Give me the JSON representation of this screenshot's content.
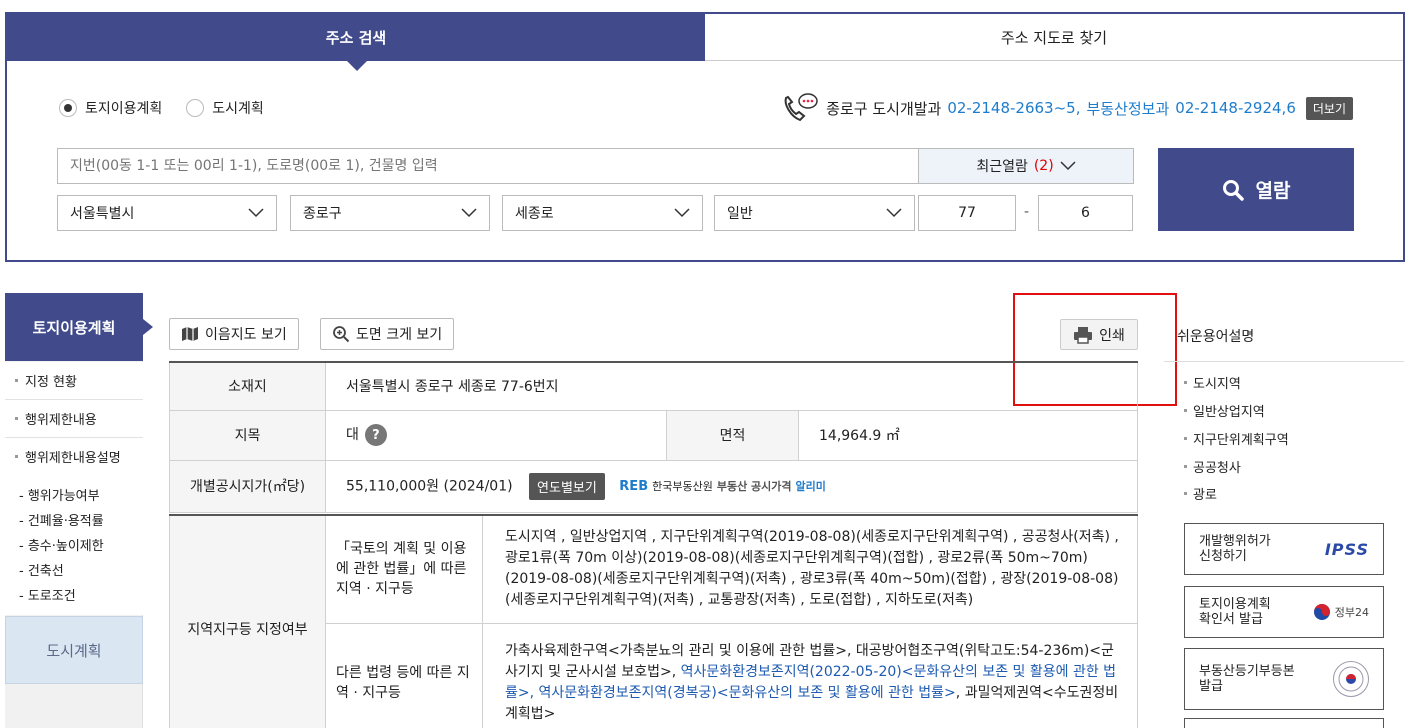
{
  "tabs": {
    "address_search": "주소 검색",
    "map_search": "주소 지도로 찾기"
  },
  "search": {
    "radio_land": "토지이용계획",
    "radio_city": "도시계획",
    "contact_label": "종로구 도시개발과",
    "contact_phone1": "02-2148-2663~5,",
    "contact_label2": "부동산정보과",
    "contact_phone2": "02-2148-2924,6",
    "more_label": "더보기",
    "placeholder": "지번(00동 1-1 또는 00리 1-1), 도로명(00로 1), 건물명 입력",
    "recent_label": "최근열람",
    "recent_count": "(2)",
    "city": "서울특별시",
    "district": "종로구",
    "road": "세종로",
    "type": "일반",
    "main_no": "77",
    "dash": "-",
    "sub_no": "6",
    "view_label": "열람"
  },
  "sidebar": {
    "title": "토지이용계획",
    "items": [
      "지정 현황",
      "행위제한내용",
      "행위제한내용설명"
    ],
    "sub_items": [
      "- 행위가능여부",
      "- 건폐율·용적률",
      "- 층수·높이제한",
      "- 건축선",
      "- 도로조건"
    ],
    "city_plan": "도시계획"
  },
  "toolbar": {
    "map_view": "이음지도 보기",
    "zoom_view": "도면 크게 보기",
    "print": "인쇄"
  },
  "table": {
    "location_label": "소재지",
    "location_value": "서울특별시 종로구 세종로 77-6번지",
    "category_label": "지목",
    "category_value": "대",
    "help": "?",
    "area_label": "면적",
    "area_value": "14,964.9 ㎡",
    "price_label": "개별공시지가(㎡당)",
    "price_value": "55,110,000원 (2024/01)",
    "yearly_btn": "연도별보기",
    "reb_logo": "REB",
    "reb_name": "한국부동산원",
    "reb_service": "부동산 공시가격",
    "reb_alimi": "알리미",
    "zone_label": "지역지구등 지정여부",
    "law1_label": "「국토의 계획 및 이용에 관한 법률」에 따른 지역 · 지구등",
    "law1_value": "도시지역 , 일반상업지역 , 지구단위계획구역(2019-08-08)(세종로지구단위계획구역) , 공공청사(저촉) , 광로1류(폭 70m 이상)(2019-08-08)(세종로지구단위계획구역)(접합) , 광로2류(폭 50m~70m)(2019-08-08)(세종로지구단위계획구역)(저촉) , 광로3류(폭 40m~50m)(접합) , 광장(2019-08-08)(세종로지구단위계획구역)(저촉) , 교통광장(저촉) , 도로(접합) , 지하도로(저촉)",
    "law2_label": "다른 법령 등에 따른 지역 · 지구등",
    "law2_part1": "가축사육제한구역<가축분뇨의 관리 및 이용에 관한 법률>, 대공방어협조구역(위탁고도:54-236m)<군사기지 및 군사시설 보호법>, ",
    "law2_link1": "역사문화환경보존지역(2022-05-20)<문화유산의 보존 및 활용에 관한 법률>, 역사문화환경보존지역(경복궁)<문화유산의 보존 및 활용에 관한 법률>",
    "law2_part2": ", 과밀억제권역<수도권정비계획법>"
  },
  "right": {
    "title": "쉬운용어설명",
    "terms": [
      "도시지역",
      "일반상업지역",
      "지구단위계획구역",
      "공공청사",
      "광로"
    ],
    "btn1_line1": "개발행위허가",
    "btn1_line2": "신청하기",
    "btn1_logo": "IPSS",
    "btn2_line1": "토지이용계획",
    "btn2_line2": "확인서 발급",
    "btn2_logo": "정부24",
    "btn3_line1": "부동산등기부등본",
    "btn3_line2": "발급"
  },
  "colors": {
    "primary": "#414b8c",
    "phone": "#1e7ccc",
    "highlight": "#e01010",
    "link": "#1e5bb0"
  }
}
